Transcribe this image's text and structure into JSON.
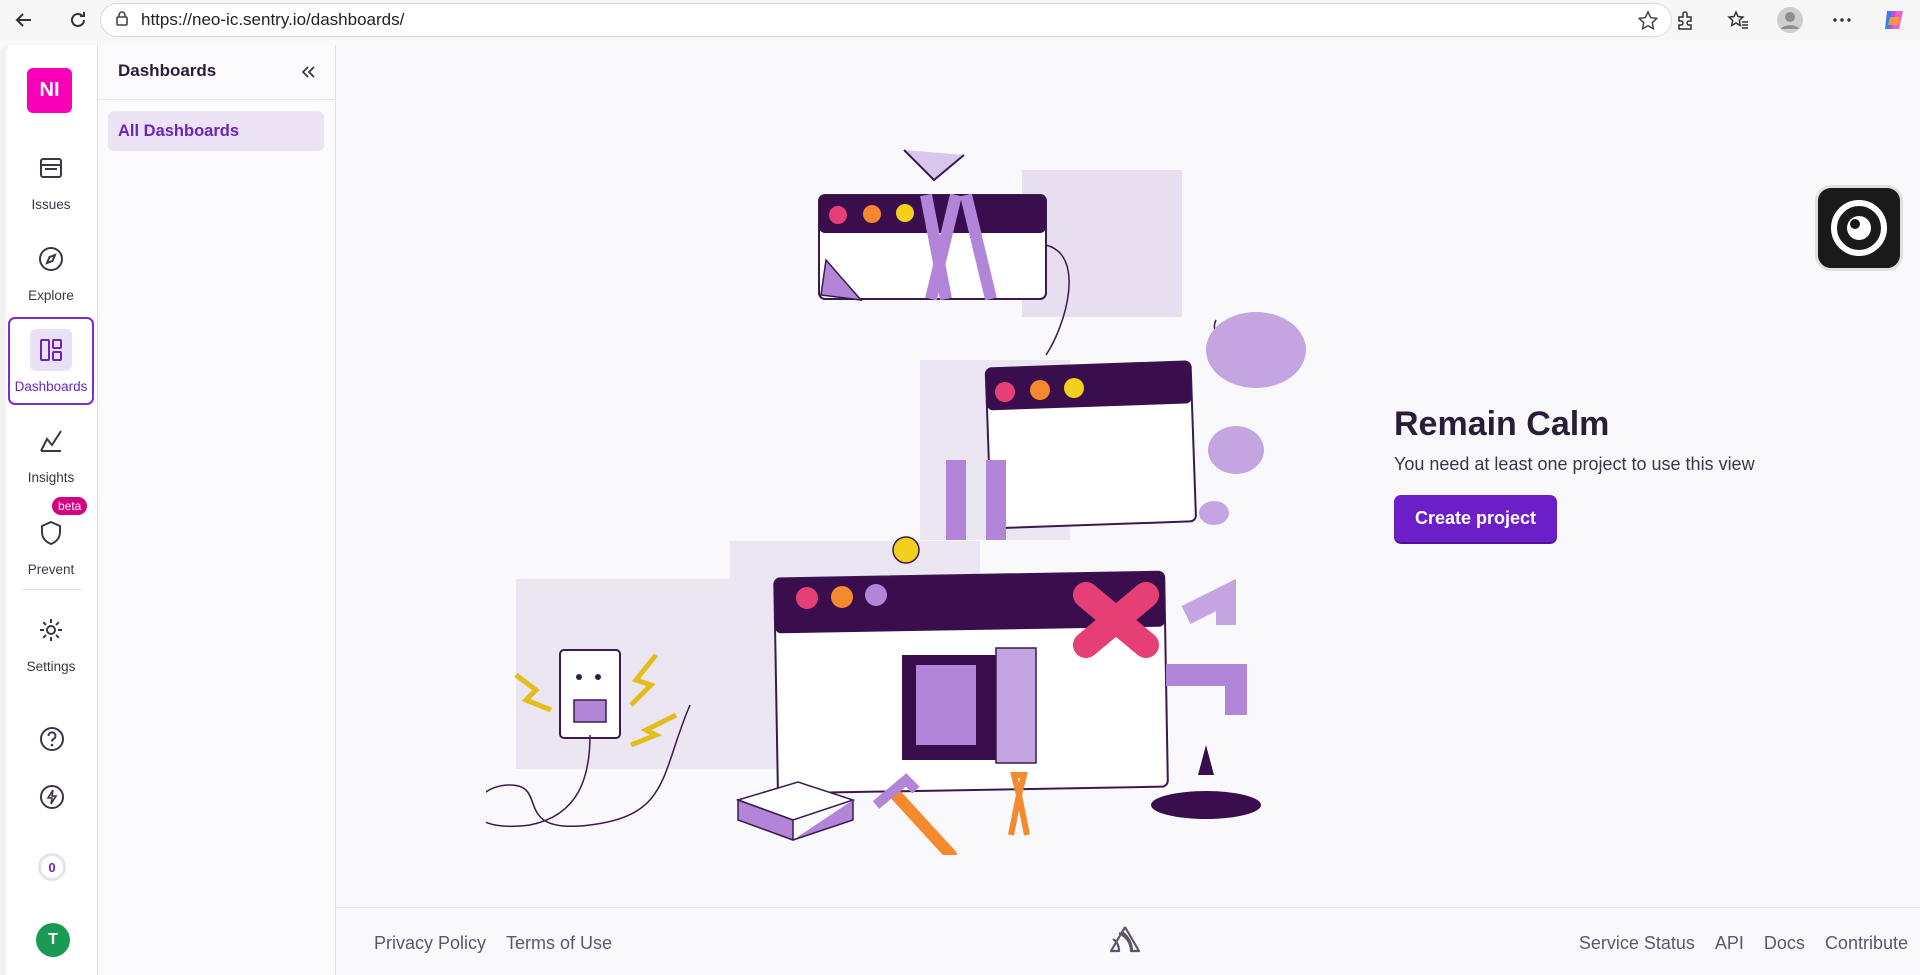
{
  "browser": {
    "url": "https://neo-ic.sentry.io/dashboards/"
  },
  "rail": {
    "org_initials": "NI",
    "items": [
      {
        "label": "Issues"
      },
      {
        "label": "Explore"
      },
      {
        "label": "Dashboards"
      },
      {
        "label": "Insights"
      },
      {
        "label": "Prevent"
      },
      {
        "label": "Settings"
      }
    ],
    "beta_badge": "beta",
    "counter": "0",
    "avatar_initial": "T"
  },
  "sidebar": {
    "title": "Dashboards",
    "items": [
      {
        "label": "All Dashboards"
      }
    ]
  },
  "empty_state": {
    "heading": "Remain Calm",
    "message": "You need at least one project to use this view",
    "button": "Create project"
  },
  "footer": {
    "left_links": [
      "Privacy Policy",
      "Terms of Use"
    ],
    "right_links": [
      "Service Status",
      "API",
      "Docs",
      "Contribute"
    ]
  },
  "colors": {
    "accent": "#6c1fc9",
    "org_badge": "#f900b6",
    "avatar": "#1a9a53",
    "beta": "#d5007f"
  }
}
